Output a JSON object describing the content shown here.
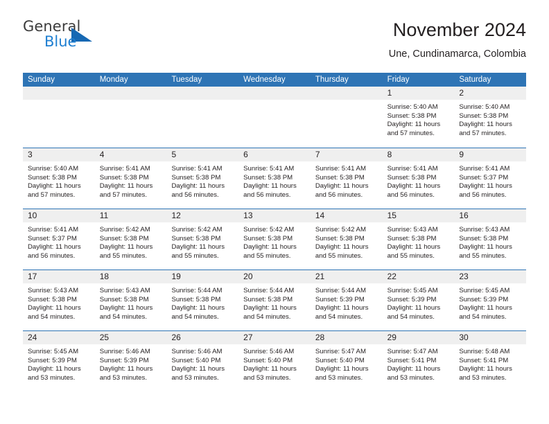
{
  "logo": {
    "word_one": "General",
    "word_two": "Blue",
    "triangle_icon": "blue-triangle-icon",
    "accent_dark": "#3c3c3c",
    "accent_blue": "#1f7fd1"
  },
  "header": {
    "title": "November 2024",
    "subtitle": "Une, Cundinamarca, Colombia"
  },
  "theme": {
    "header_bar_blue": "#2e74b5",
    "day_band_gray": "#efefef",
    "text": "#231f20"
  },
  "calendar": {
    "weekdays": [
      "Sunday",
      "Monday",
      "Tuesday",
      "Wednesday",
      "Thursday",
      "Friday",
      "Saturday"
    ],
    "weeks": [
      [
        {
          "day": "",
          "sunrise": "",
          "sunset": "",
          "daylight_line1": "",
          "daylight_line2": ""
        },
        {
          "day": "",
          "sunrise": "",
          "sunset": "",
          "daylight_line1": "",
          "daylight_line2": ""
        },
        {
          "day": "",
          "sunrise": "",
          "sunset": "",
          "daylight_line1": "",
          "daylight_line2": ""
        },
        {
          "day": "",
          "sunrise": "",
          "sunset": "",
          "daylight_line1": "",
          "daylight_line2": ""
        },
        {
          "day": "",
          "sunrise": "",
          "sunset": "",
          "daylight_line1": "",
          "daylight_line2": ""
        },
        {
          "day": "1",
          "sunrise": "Sunrise: 5:40 AM",
          "sunset": "Sunset: 5:38 PM",
          "daylight_line1": "Daylight: 11 hours",
          "daylight_line2": "and 57 minutes."
        },
        {
          "day": "2",
          "sunrise": "Sunrise: 5:40 AM",
          "sunset": "Sunset: 5:38 PM",
          "daylight_line1": "Daylight: 11 hours",
          "daylight_line2": "and 57 minutes."
        }
      ],
      [
        {
          "day": "3",
          "sunrise": "Sunrise: 5:40 AM",
          "sunset": "Sunset: 5:38 PM",
          "daylight_line1": "Daylight: 11 hours",
          "daylight_line2": "and 57 minutes."
        },
        {
          "day": "4",
          "sunrise": "Sunrise: 5:41 AM",
          "sunset": "Sunset: 5:38 PM",
          "daylight_line1": "Daylight: 11 hours",
          "daylight_line2": "and 57 minutes."
        },
        {
          "day": "5",
          "sunrise": "Sunrise: 5:41 AM",
          "sunset": "Sunset: 5:38 PM",
          "daylight_line1": "Daylight: 11 hours",
          "daylight_line2": "and 56 minutes."
        },
        {
          "day": "6",
          "sunrise": "Sunrise: 5:41 AM",
          "sunset": "Sunset: 5:38 PM",
          "daylight_line1": "Daylight: 11 hours",
          "daylight_line2": "and 56 minutes."
        },
        {
          "day": "7",
          "sunrise": "Sunrise: 5:41 AM",
          "sunset": "Sunset: 5:38 PM",
          "daylight_line1": "Daylight: 11 hours",
          "daylight_line2": "and 56 minutes."
        },
        {
          "day": "8",
          "sunrise": "Sunrise: 5:41 AM",
          "sunset": "Sunset: 5:38 PM",
          "daylight_line1": "Daylight: 11 hours",
          "daylight_line2": "and 56 minutes."
        },
        {
          "day": "9",
          "sunrise": "Sunrise: 5:41 AM",
          "sunset": "Sunset: 5:37 PM",
          "daylight_line1": "Daylight: 11 hours",
          "daylight_line2": "and 56 minutes."
        }
      ],
      [
        {
          "day": "10",
          "sunrise": "Sunrise: 5:41 AM",
          "sunset": "Sunset: 5:37 PM",
          "daylight_line1": "Daylight: 11 hours",
          "daylight_line2": "and 56 minutes."
        },
        {
          "day": "11",
          "sunrise": "Sunrise: 5:42 AM",
          "sunset": "Sunset: 5:38 PM",
          "daylight_line1": "Daylight: 11 hours",
          "daylight_line2": "and 55 minutes."
        },
        {
          "day": "12",
          "sunrise": "Sunrise: 5:42 AM",
          "sunset": "Sunset: 5:38 PM",
          "daylight_line1": "Daylight: 11 hours",
          "daylight_line2": "and 55 minutes."
        },
        {
          "day": "13",
          "sunrise": "Sunrise: 5:42 AM",
          "sunset": "Sunset: 5:38 PM",
          "daylight_line1": "Daylight: 11 hours",
          "daylight_line2": "and 55 minutes."
        },
        {
          "day": "14",
          "sunrise": "Sunrise: 5:42 AM",
          "sunset": "Sunset: 5:38 PM",
          "daylight_line1": "Daylight: 11 hours",
          "daylight_line2": "and 55 minutes."
        },
        {
          "day": "15",
          "sunrise": "Sunrise: 5:43 AM",
          "sunset": "Sunset: 5:38 PM",
          "daylight_line1": "Daylight: 11 hours",
          "daylight_line2": "and 55 minutes."
        },
        {
          "day": "16",
          "sunrise": "Sunrise: 5:43 AM",
          "sunset": "Sunset: 5:38 PM",
          "daylight_line1": "Daylight: 11 hours",
          "daylight_line2": "and 55 minutes."
        }
      ],
      [
        {
          "day": "17",
          "sunrise": "Sunrise: 5:43 AM",
          "sunset": "Sunset: 5:38 PM",
          "daylight_line1": "Daylight: 11 hours",
          "daylight_line2": "and 54 minutes."
        },
        {
          "day": "18",
          "sunrise": "Sunrise: 5:43 AM",
          "sunset": "Sunset: 5:38 PM",
          "daylight_line1": "Daylight: 11 hours",
          "daylight_line2": "and 54 minutes."
        },
        {
          "day": "19",
          "sunrise": "Sunrise: 5:44 AM",
          "sunset": "Sunset: 5:38 PM",
          "daylight_line1": "Daylight: 11 hours",
          "daylight_line2": "and 54 minutes."
        },
        {
          "day": "20",
          "sunrise": "Sunrise: 5:44 AM",
          "sunset": "Sunset: 5:38 PM",
          "daylight_line1": "Daylight: 11 hours",
          "daylight_line2": "and 54 minutes."
        },
        {
          "day": "21",
          "sunrise": "Sunrise: 5:44 AM",
          "sunset": "Sunset: 5:39 PM",
          "daylight_line1": "Daylight: 11 hours",
          "daylight_line2": "and 54 minutes."
        },
        {
          "day": "22",
          "sunrise": "Sunrise: 5:45 AM",
          "sunset": "Sunset: 5:39 PM",
          "daylight_line1": "Daylight: 11 hours",
          "daylight_line2": "and 54 minutes."
        },
        {
          "day": "23",
          "sunrise": "Sunrise: 5:45 AM",
          "sunset": "Sunset: 5:39 PM",
          "daylight_line1": "Daylight: 11 hours",
          "daylight_line2": "and 54 minutes."
        }
      ],
      [
        {
          "day": "24",
          "sunrise": "Sunrise: 5:45 AM",
          "sunset": "Sunset: 5:39 PM",
          "daylight_line1": "Daylight: 11 hours",
          "daylight_line2": "and 53 minutes."
        },
        {
          "day": "25",
          "sunrise": "Sunrise: 5:46 AM",
          "sunset": "Sunset: 5:39 PM",
          "daylight_line1": "Daylight: 11 hours",
          "daylight_line2": "and 53 minutes."
        },
        {
          "day": "26",
          "sunrise": "Sunrise: 5:46 AM",
          "sunset": "Sunset: 5:40 PM",
          "daylight_line1": "Daylight: 11 hours",
          "daylight_line2": "and 53 minutes."
        },
        {
          "day": "27",
          "sunrise": "Sunrise: 5:46 AM",
          "sunset": "Sunset: 5:40 PM",
          "daylight_line1": "Daylight: 11 hours",
          "daylight_line2": "and 53 minutes."
        },
        {
          "day": "28",
          "sunrise": "Sunrise: 5:47 AM",
          "sunset": "Sunset: 5:40 PM",
          "daylight_line1": "Daylight: 11 hours",
          "daylight_line2": "and 53 minutes."
        },
        {
          "day": "29",
          "sunrise": "Sunrise: 5:47 AM",
          "sunset": "Sunset: 5:41 PM",
          "daylight_line1": "Daylight: 11 hours",
          "daylight_line2": "and 53 minutes."
        },
        {
          "day": "30",
          "sunrise": "Sunrise: 5:48 AM",
          "sunset": "Sunset: 5:41 PM",
          "daylight_line1": "Daylight: 11 hours",
          "daylight_line2": "and 53 minutes."
        }
      ]
    ]
  }
}
